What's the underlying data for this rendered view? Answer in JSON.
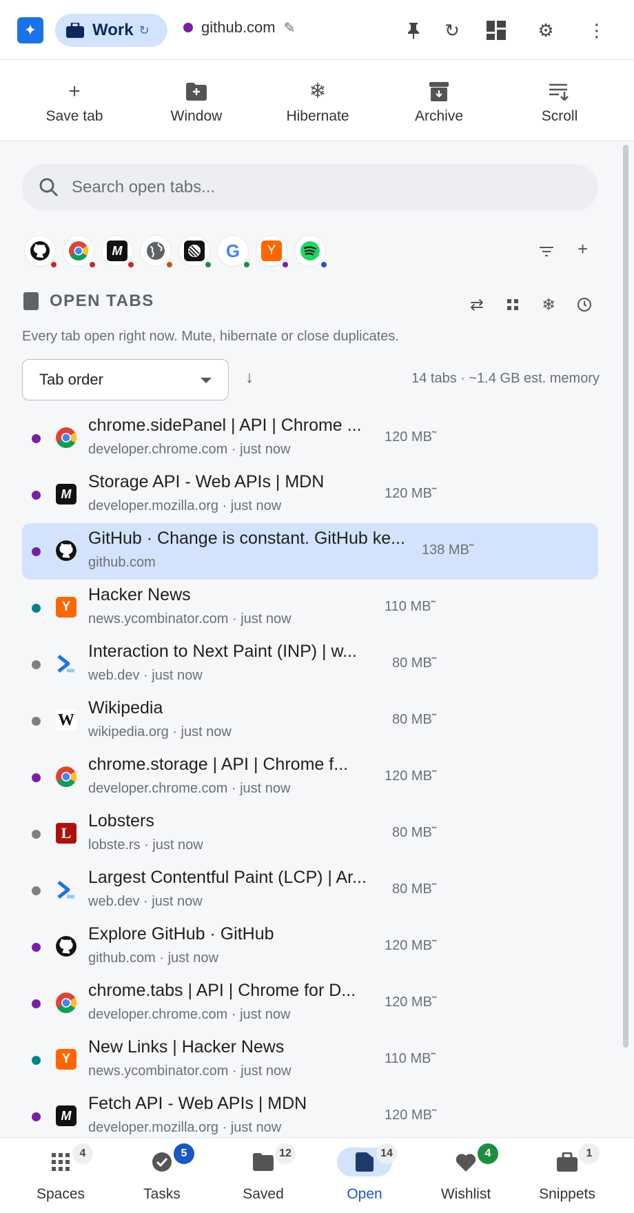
{
  "header": {
    "space_name": "Work",
    "domain": "github.com",
    "domain_dot_color": "#7b1fa2"
  },
  "actions": [
    {
      "label": "Save tab",
      "icon": "plus-icon"
    },
    {
      "label": "Window",
      "icon": "folder-plus-icon"
    },
    {
      "label": "Hibernate",
      "icon": "snowflake-icon"
    },
    {
      "label": "Archive",
      "icon": "archive-icon"
    },
    {
      "label": "Scroll",
      "icon": "sort-list-icon"
    }
  ],
  "search": {
    "placeholder": "Search open tabs..."
  },
  "favicons": [
    {
      "name": "github",
      "badge": "#c62828"
    },
    {
      "name": "chrome",
      "badge": "#c62828"
    },
    {
      "name": "mdn",
      "badge": "#c62828"
    },
    {
      "name": "globe",
      "badge": "#b25f00"
    },
    {
      "name": "linear",
      "badge": "#1e8e3e"
    },
    {
      "name": "google",
      "badge": "#1e8e3e"
    },
    {
      "name": "ycombinator",
      "badge": "#7b1fa2"
    },
    {
      "name": "spotify",
      "badge": "#1a56c4"
    }
  ],
  "section": {
    "title": "OPEN TABS",
    "description": "Every tab open right now. Mute, hibernate or close duplicates."
  },
  "sort": {
    "selected": "Tab order",
    "summary": "14 tabs · ~1.4 GB est. memory"
  },
  "tabs": [
    {
      "title": "chrome.sidePanel  |  API  |  Chrome ...",
      "meta": "developer.chrome.com · just now",
      "mem": "120 MB˜",
      "status": "#7b1fa2",
      "icon": "chrome"
    },
    {
      "title": "Storage API - Web APIs | MDN",
      "meta": "developer.mozilla.org · just now",
      "mem": "120 MB˜",
      "status": "#7b1fa2",
      "icon": "mdn"
    },
    {
      "title": "GitHub · Change is constant. GitHub ke...",
      "meta": "github.com",
      "mem": "138 MB˜",
      "status": "#7b1fa2",
      "icon": "github",
      "selected": true
    },
    {
      "title": "Hacker News",
      "meta": "news.ycombinator.com · just now",
      "mem": "110 MB˜",
      "status": "#00838f",
      "icon": "ycombinator"
    },
    {
      "title": "Interaction to Next Paint (INP)  |  w...",
      "meta": "web.dev · just now",
      "mem": "80 MB˜",
      "status": "#808080",
      "icon": "webdev"
    },
    {
      "title": "Wikipedia",
      "meta": "wikipedia.org · just now",
      "mem": "80 MB˜",
      "status": "#808080",
      "icon": "wikipedia"
    },
    {
      "title": "chrome.storage  |  API  |  Chrome f...",
      "meta": "developer.chrome.com · just now",
      "mem": "120 MB˜",
      "status": "#7b1fa2",
      "icon": "chrome"
    },
    {
      "title": "Lobsters",
      "meta": "lobste.rs · just now",
      "mem": "80 MB˜",
      "status": "#808080",
      "icon": "lobsters"
    },
    {
      "title": "Largest Contentful Paint (LCP)  |  Ar...",
      "meta": "web.dev · just now",
      "mem": "80 MB˜",
      "status": "#808080",
      "icon": "webdev"
    },
    {
      "title": "Explore GitHub · GitHub",
      "meta": "github.com · just now",
      "mem": "120 MB˜",
      "status": "#7b1fa2",
      "icon": "github"
    },
    {
      "title": "chrome.tabs  |  API  |  Chrome for D...",
      "meta": "developer.chrome.com · just now",
      "mem": "120 MB˜",
      "status": "#7b1fa2",
      "icon": "chrome"
    },
    {
      "title": "New Links | Hacker News",
      "meta": "news.ycombinator.com · just now",
      "mem": "110 MB˜",
      "status": "#00838f",
      "icon": "ycombinator"
    },
    {
      "title": "Fetch API - Web APIs | MDN",
      "meta": "developer.mozilla.org · just now",
      "mem": "120 MB˜",
      "status": "#7b1fa2",
      "icon": "mdn"
    }
  ],
  "nav": [
    {
      "label": "Spaces",
      "count": "4",
      "icon": "grid-icon",
      "count_style": "grey"
    },
    {
      "label": "Tasks",
      "count": "5",
      "icon": "check-circle-icon",
      "count_style": "blue"
    },
    {
      "label": "Saved",
      "count": "12",
      "icon": "folder-icon",
      "count_style": "grey"
    },
    {
      "label": "Open",
      "count": "14",
      "icon": "file-icon",
      "count_style": "grey",
      "active": true
    },
    {
      "label": "Wishlist",
      "count": "4",
      "icon": "heart-icon",
      "count_style": "green"
    },
    {
      "label": "Snippets",
      "count": "1",
      "icon": "briefcase-icon",
      "count_style": "grey"
    }
  ]
}
